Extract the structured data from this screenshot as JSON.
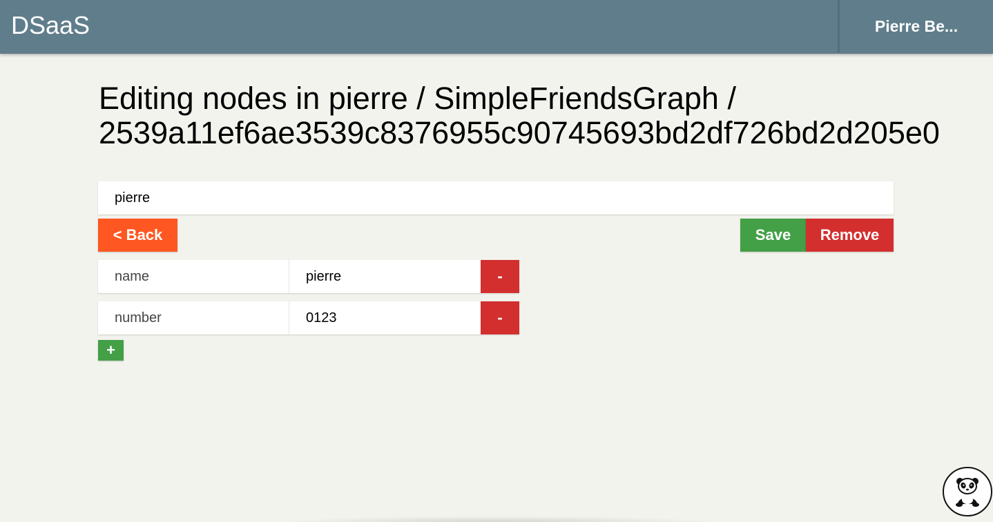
{
  "header": {
    "brand": "DSaaS",
    "user_name": "Pierre Be..."
  },
  "page": {
    "title_line1": "Editing nodes in pierre / SimpleFriendsGraph /",
    "title_line2": "2539a11ef6ae3539c8376955c90745693bd2df726bd2d205e0"
  },
  "node": {
    "name_value": "pierre"
  },
  "actions": {
    "back_label": "< Back",
    "save_label": "Save",
    "remove_label": "Remove",
    "add_property_label": "+"
  },
  "properties": [
    {
      "key": "name",
      "value": "pierre",
      "remove_label": "-"
    },
    {
      "key": "number",
      "value": "0123",
      "remove_label": "-"
    }
  ],
  "colors": {
    "header_bg": "#607d8b",
    "page_bg": "#f3f3ee",
    "back_button": "#ff5722",
    "save_button": "#43a047",
    "remove_button": "#d32f2f"
  },
  "icons": {
    "assistant": "panda-icon"
  }
}
